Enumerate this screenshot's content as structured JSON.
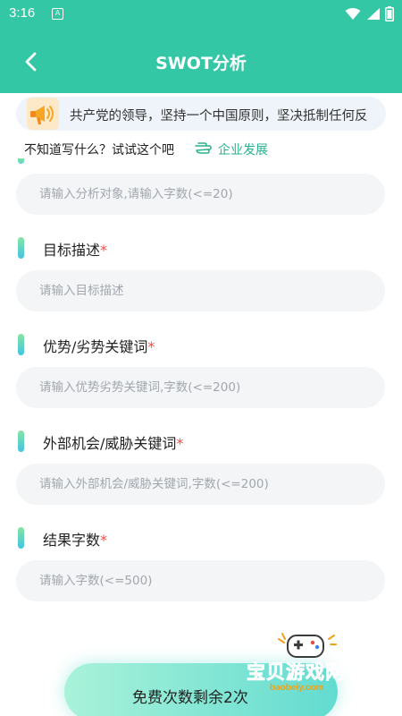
{
  "status_bar": {
    "time": "3:16",
    "app_letter": "A"
  },
  "header": {
    "title": "SWOT分析"
  },
  "notice": {
    "text": "共产党的领导，坚持一个中国原则，坚决抵制任何反"
  },
  "hint": {
    "text": "不知道写什么？试试这个吧",
    "link": "企业发展"
  },
  "form": {
    "object_field": {
      "placeholder": "请输入分析对象,请输入字数(<=20)"
    },
    "goal_field": {
      "label": "目标描述",
      "required_mark": "*",
      "placeholder": "请输入目标描述"
    },
    "strength_field": {
      "label": "优势/劣势关键词",
      "required_mark": "*",
      "placeholder": "请输入优势劣势关键词,字数(<=200)"
    },
    "opportunity_field": {
      "label": "外部机会/威胁关键词",
      "required_mark": "*",
      "placeholder": "请输入外部机会/威胁关键词,字数(<=200)"
    },
    "count_field": {
      "label": "结果字数",
      "required_mark": "*",
      "placeholder": "请输入字数(<=500)"
    }
  },
  "submit": {
    "label": "免费次数剩余2次"
  },
  "watermark": {
    "text": "宝贝游戏网",
    "url": "baobeiy.com"
  },
  "colors": {
    "primary": "#33c7a5",
    "link": "#27b28f",
    "required": "#f04c46",
    "input_bg": "#f3f5f7",
    "watermark": "#f0a21a"
  },
  "icons": [
    "back-arrow-icon",
    "megaphone-icon",
    "pointing-hand-icon",
    "wifi-icon",
    "signal-icon",
    "battery-icon",
    "gamepad-icon"
  ]
}
